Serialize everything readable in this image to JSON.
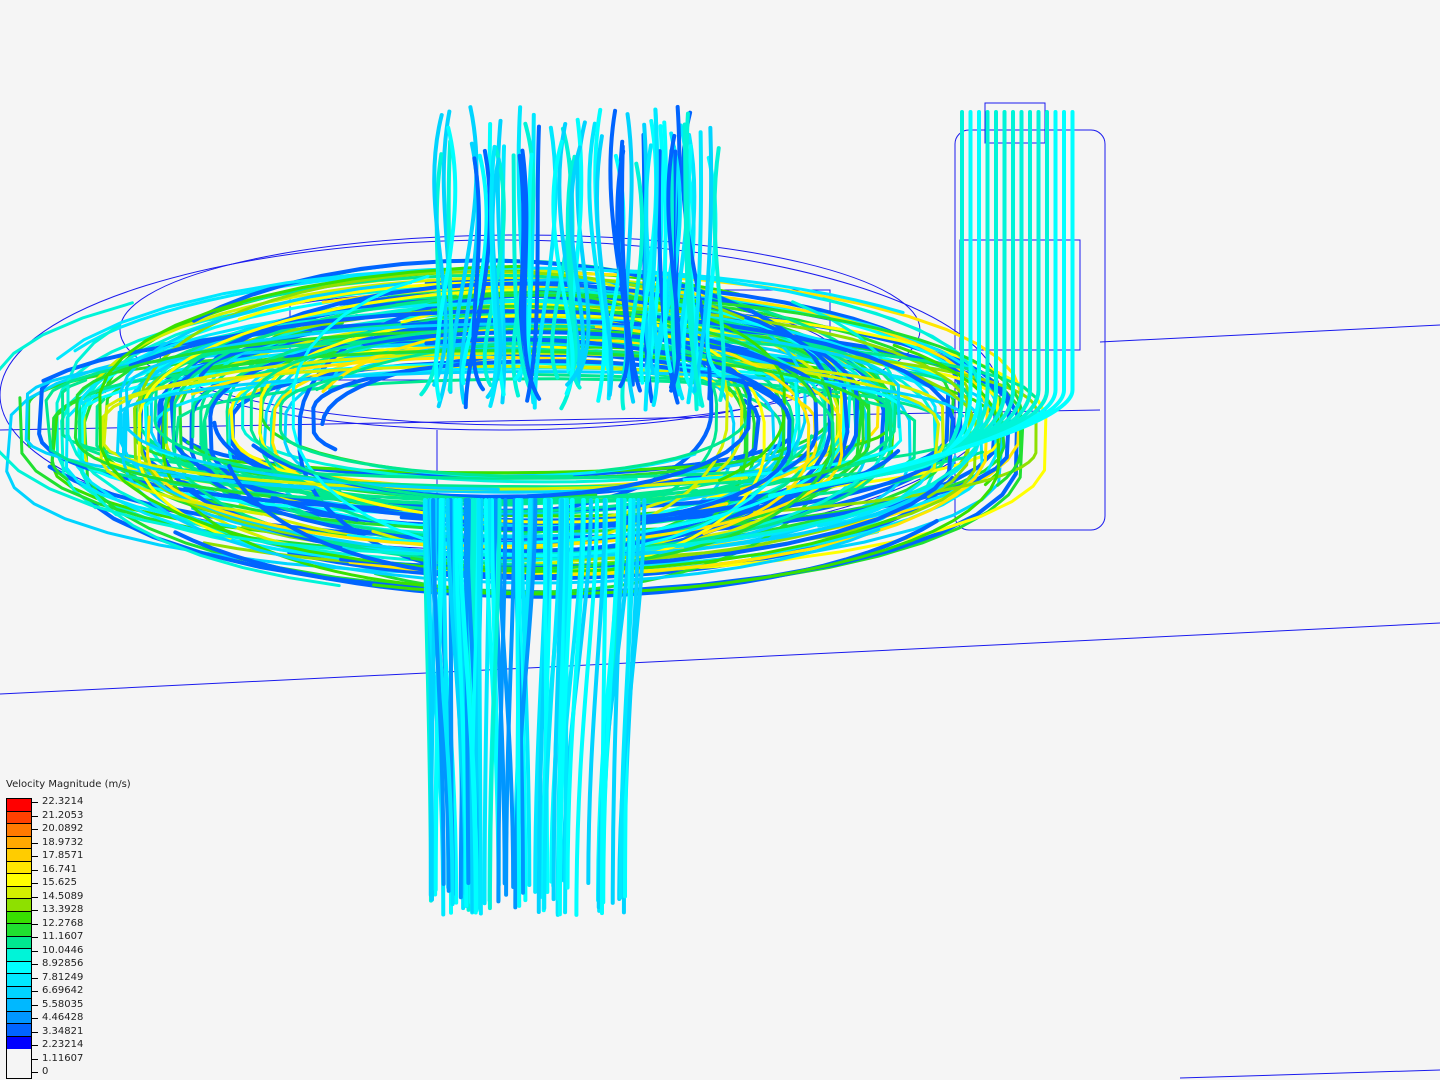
{
  "legend": {
    "title": "Velocity Magnitude (m/s)",
    "labels": [
      "22.3214",
      "21.2053",
      "20.0892",
      "18.9732",
      "17.8571",
      "16.741",
      "15.625",
      "14.5089",
      "13.3928",
      "12.2768",
      "11.1607",
      "10.0446",
      "8.92856",
      "7.81249",
      "6.69642",
      "5.58035",
      "4.46428",
      "3.34821",
      "2.23214",
      "1.11607",
      "0"
    ],
    "colors": [
      "#ff0000",
      "#ff4000",
      "#ff7a00",
      "#ffa800",
      "#ffcc00",
      "#ffe600",
      "#ffff00",
      "#d4f000",
      "#8ee000",
      "#38e000",
      "#20e030",
      "#00e890",
      "#00f4d8",
      "#00ffff",
      "#00e8ff",
      "#00d4ff",
      "#00b8ff",
      "#0096ff",
      "#0064ff",
      "#0000ff"
    ],
    "range": [
      0,
      22.3214
    ]
  },
  "scene": {
    "wireframe_color": "#1a1aee",
    "background": "#f5f5f5"
  }
}
